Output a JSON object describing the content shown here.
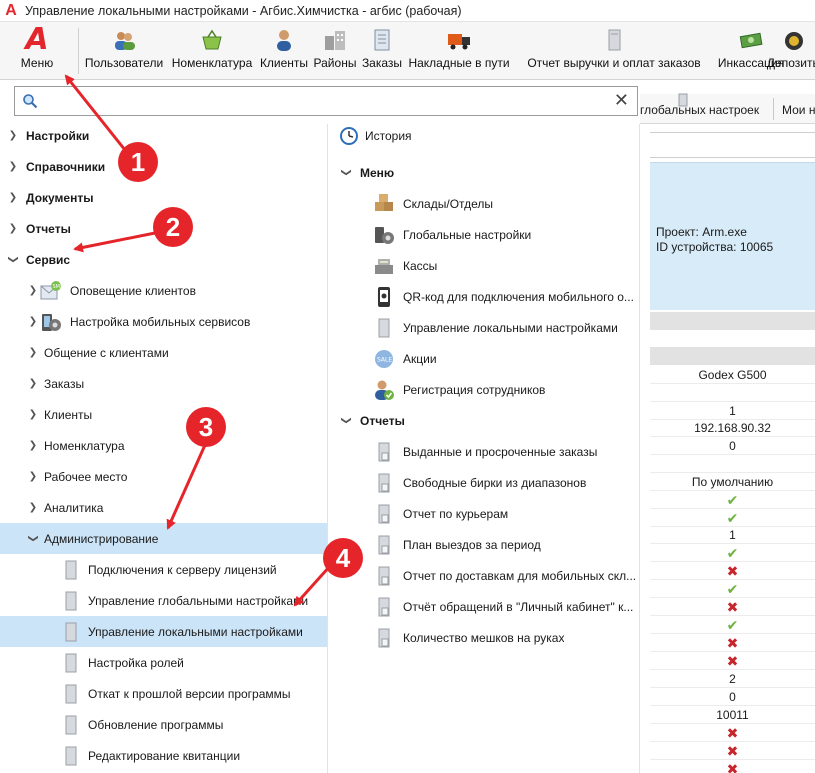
{
  "window": {
    "title": "Управление локальными настройками - Агбис.Химчистка - агбис (рабочая)",
    "app_glyph": "A"
  },
  "toolbar": {
    "menu_label": "Меню",
    "buttons": [
      {
        "label": "Пользователи",
        "icon": "users-icon"
      },
      {
        "label": "Номенклатура",
        "icon": "basket-icon"
      },
      {
        "label": "Клиенты",
        "icon": "client-icon"
      },
      {
        "label": "Районы",
        "icon": "buildings-icon"
      },
      {
        "label": "Заказы",
        "icon": "document-icon"
      },
      {
        "label": "Накладные в пути",
        "icon": "truck-icon"
      },
      {
        "label": "Отчет выручки и оплат заказов",
        "icon": "report-icon"
      },
      {
        "label": "Инкассация",
        "icon": "money-icon"
      },
      {
        "label": "Депозиты",
        "icon": "deposit-icon"
      }
    ]
  },
  "search": {
    "value": "",
    "placeholder": ""
  },
  "tree": {
    "top": [
      {
        "label": "Настройки"
      },
      {
        "label": "Справочники"
      },
      {
        "label": "Документы"
      },
      {
        "label": "Отчеты"
      },
      {
        "label": "Сервис"
      }
    ],
    "service_children": [
      {
        "label": "Оповещение клиентов"
      },
      {
        "label": "Настройка мобильных сервисов"
      },
      {
        "label": "Общение с клиентами"
      },
      {
        "label": "Заказы"
      },
      {
        "label": "Клиенты"
      },
      {
        "label": "Номенклатура"
      },
      {
        "label": "Рабочее место"
      },
      {
        "label": "Аналитика"
      },
      {
        "label": "Администрирование"
      }
    ],
    "admin_children": [
      {
        "label": "Подключения к серверу лицензий"
      },
      {
        "label": "Управление глобальными настройками"
      },
      {
        "label": "Управление локальными настройками"
      },
      {
        "label": "Настройка ролей"
      },
      {
        "label": "Откат к прошлой версии программы"
      },
      {
        "label": "Обновление программы"
      },
      {
        "label": "Редактирование квитанции"
      }
    ]
  },
  "middle": {
    "history_label": "История",
    "menu_header": "Меню",
    "menu_items": [
      {
        "label": "Склады/Отделы"
      },
      {
        "label": "Глобальные настройки"
      },
      {
        "label": "Кассы"
      },
      {
        "label": "QR-код для подключения мобильного о..."
      },
      {
        "label": "Управление локальными настройками"
      },
      {
        "label": "Акции"
      },
      {
        "label": "Регистрация сотрудников"
      }
    ],
    "reports_header": "Отчеты",
    "report_items": [
      {
        "label": "Выданные и просроченные заказы"
      },
      {
        "label": "Свободные бирки из диапазонов"
      },
      {
        "label": "Отчет по курьерам"
      },
      {
        "label": "План выездов за период"
      },
      {
        "label": "Отчет по доставкам для мобильных скл..."
      },
      {
        "label": "Отчёт обращений в \"Личный кабинет\" к..."
      },
      {
        "label": "Количество мешков на руках"
      }
    ]
  },
  "right": {
    "tabs": [
      "глобальных настроек",
      "Мои н"
    ],
    "project_line": "Проект: Arm.exe",
    "device_line": "ID устройства: 10065",
    "cells": [
      "Godex G500",
      "",
      "1",
      "192.168.90.32",
      "0",
      "",
      "По умолчанию",
      "✔",
      "✔",
      "1",
      "✔",
      "✖",
      "✔",
      "✖",
      "✔",
      "✖",
      "✖",
      "2",
      "0",
      "10011",
      "✖",
      "✖",
      "✖"
    ]
  },
  "annotations": [
    "1",
    "2",
    "3",
    "4"
  ],
  "colors": {
    "accent": "#e5252a",
    "selection": "#cce4f7",
    "header_blue": "#d8ebf8",
    "check": "#6db33f",
    "cross": "#c8262d"
  }
}
